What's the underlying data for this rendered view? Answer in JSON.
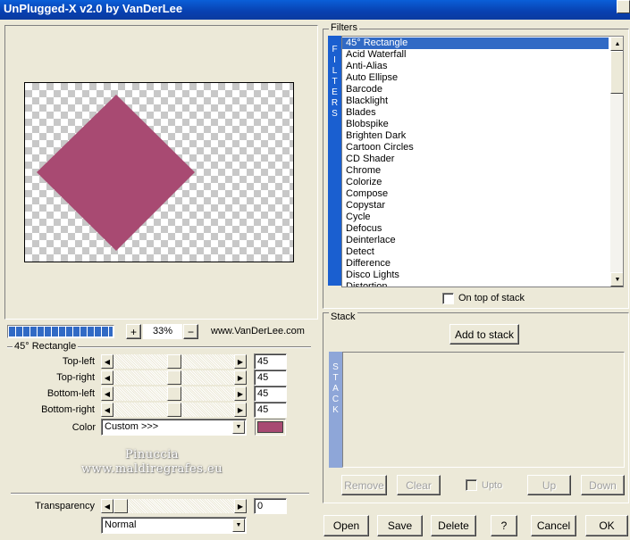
{
  "window": {
    "title": "UnPlugged-X v2.0 by VanDerLee"
  },
  "colors": {
    "shape": "#a84a72",
    "selection": "#316ac5",
    "tab": "#1a5fd0"
  },
  "preview": {
    "zoom": "33%",
    "zoom_in": "+",
    "zoom_out": "−",
    "website": "www.VanDerLee.com",
    "progress": 1.0
  },
  "params": {
    "title": "45° Rectangle",
    "sliders": [
      {
        "label": "Top-left",
        "value": "45",
        "level": 0.5
      },
      {
        "label": "Top-right",
        "value": "45",
        "level": 0.5
      },
      {
        "label": "Bottom-left",
        "value": "45",
        "level": 0.5
      },
      {
        "label": "Bottom-right",
        "value": "45",
        "level": 0.5
      }
    ],
    "color_label": "Color",
    "color_value": "Custom >>>",
    "transparency_label": "Transparency",
    "transparency_value": "0",
    "transparency_level": 0.0,
    "blend_mode": "Normal"
  },
  "filters": {
    "group_label": "Filters",
    "tab_letters": [
      "F",
      "I",
      "L",
      "T",
      "E",
      "R",
      "S"
    ],
    "selected_index": 0,
    "items": [
      "45° Rectangle",
      "Acid Waterfall",
      "Anti-Alias",
      "Auto Ellipse",
      "Barcode",
      "Blacklight",
      "Blades",
      "Blobspike",
      "Brighten Dark",
      "Cartoon Circles",
      "CD Shader",
      "Chrome",
      "Colorize",
      "Compose",
      "Copystar",
      "Cycle",
      "Defocus",
      "Deinterlace",
      "Detect",
      "Difference",
      "Disco Lights",
      "Distortion"
    ],
    "on_top_label": "On top of stack"
  },
  "stack": {
    "group_label": "Stack",
    "add_button": "Add to stack",
    "tab_letters": [
      "S",
      "T",
      "A",
      "C",
      "K"
    ],
    "remove": "Remove",
    "clear": "Clear",
    "upto": "Upto",
    "up": "Up",
    "down": "Down"
  },
  "watermark": {
    "line1": "Pinuccia",
    "line2": "www.maldiregrafes.eu"
  },
  "buttons": {
    "open": "Open",
    "save": "Save",
    "delete": "Delete",
    "help": "?",
    "cancel": "Cancel",
    "ok": "OK"
  },
  "icons": {
    "close": "close-icon",
    "left": "arrow-left-icon",
    "right": "arrow-right-icon",
    "up": "arrow-up-icon",
    "down": "arrow-down-icon"
  }
}
